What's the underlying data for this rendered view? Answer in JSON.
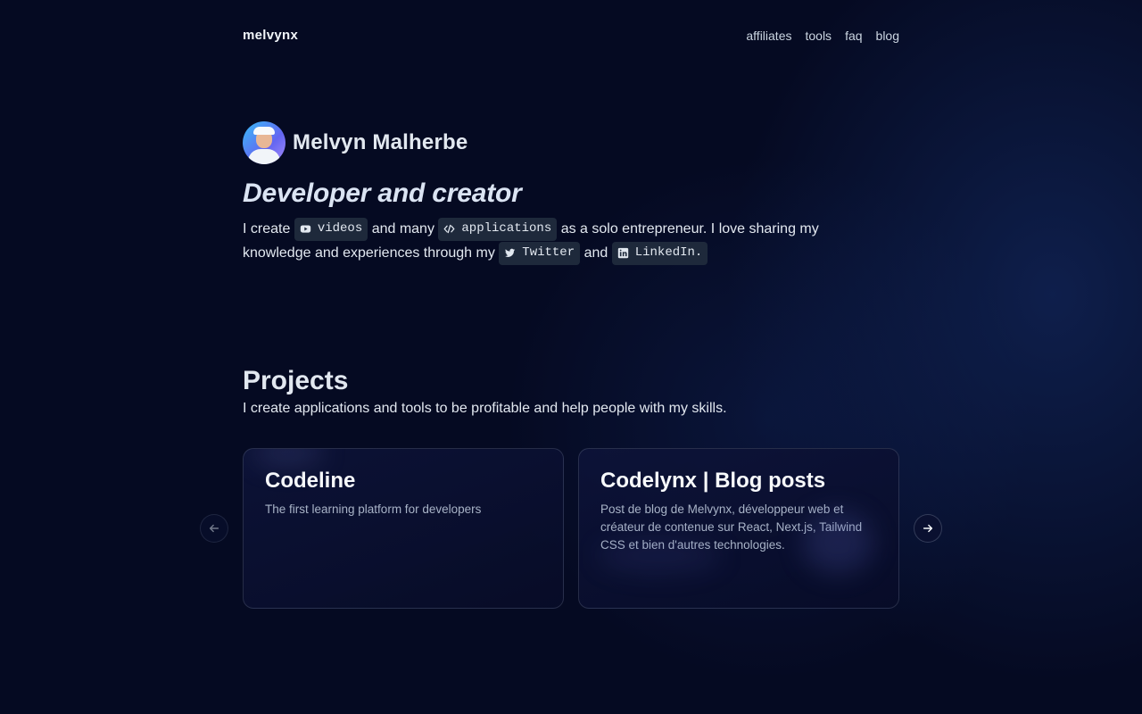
{
  "header": {
    "logo": "melvynx",
    "nav": [
      "affiliates",
      "tools",
      "faq",
      "blog"
    ]
  },
  "hero": {
    "name": "Melvyn Malherbe",
    "tagline": "Developer and creator",
    "intro": {
      "t1": "I create",
      "chip_videos": "videos",
      "t2": "and many",
      "chip_applications": "applications",
      "t3": "as a solo entrepreneur. I love sharing my knowledge and experiences through my",
      "chip_twitter": "Twitter",
      "t4": "and",
      "chip_linkedin": "LinkedIn."
    }
  },
  "projects": {
    "title": "Projects",
    "subtitle": "I create applications and tools to be profitable and help people with my skills.",
    "cards": [
      {
        "title": "Codeline",
        "description": "The first learning platform for developers"
      },
      {
        "title": "Codelynx | Blog posts",
        "description": "Post de blog de Melvynx, développeur web et créateur de contenue sur React, Next.js, Tailwind CSS et bien d'autres technologies."
      }
    ]
  },
  "icons": {
    "videos": "youtube-icon",
    "applications": "code-icon",
    "twitter": "twitter-icon",
    "linkedin": "linkedin-icon",
    "prev": "arrow-left-icon",
    "next": "arrow-right-icon"
  }
}
